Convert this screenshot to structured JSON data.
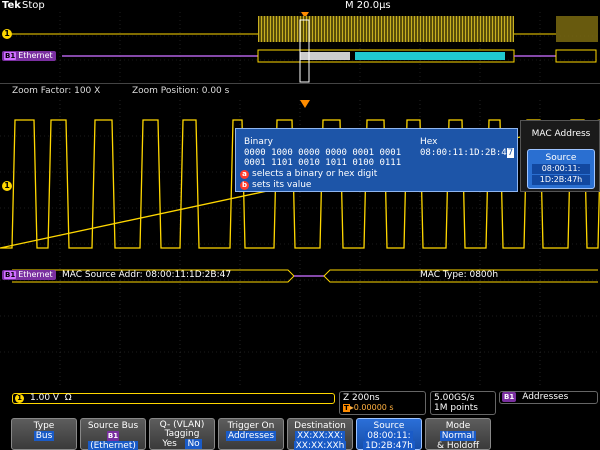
{
  "top": {
    "logo": "Tek",
    "acq_state": "Stop",
    "timebase": "M 20.0µs"
  },
  "overview": {
    "bus_label": "Ethernet",
    "bus_badge": "B1"
  },
  "zoom": {
    "factor": "Zoom Factor: 100 X",
    "position": "Zoom Position: 0.00 s"
  },
  "main": {
    "bus_label": "Ethernet",
    "bus_badge": "B1",
    "channel_marker": "1",
    "decode_left": "MAC Source Addr: 08:00:11:1D:2B:47",
    "decode_right": "MAC Type: 0800h"
  },
  "popup": {
    "binary_label": "Binary",
    "hex_label": "Hex",
    "binary_line1": "0000 1000  0000 0000  0001 0001",
    "binary_line2": "0001 1101  0010 1011  0100 0111",
    "hex_value_prefix": "08:00:11:1D:2B:4",
    "hex_value_cursor": "7",
    "hint_a_knob": "a",
    "hint_a": "selects a binary or hex digit",
    "hint_b_knob": "b",
    "hint_b": "sets its value"
  },
  "side_menu": {
    "title": "MAC Address",
    "source_label": "Source",
    "source_line1": "08:00:11:",
    "source_line2": "1D:2B:47h"
  },
  "info": {
    "ch1_badge": "1",
    "ch1_scale": "1.00 V",
    "ch1_term": "Ω",
    "horiz_scale": "Z 200ns",
    "horiz_trig_mark": "T",
    "horiz_delay": "▸0.00000 s",
    "sample_rate": "5.00GS/s",
    "record_length": "1M points",
    "bus_badge": "B1",
    "bus_trigger_type": "Addresses"
  },
  "bottom_menu": {
    "type_label": "Type",
    "type_value": "Bus",
    "source_bus_label": "Source Bus",
    "source_bus_badge": "B1",
    "source_bus_value": "(Ethernet)",
    "vlan_label": "Q- (VLAN)",
    "vlan_label2": "Tagging",
    "vlan_yes": "Yes",
    "vlan_no": "No",
    "trigger_on_label": "Trigger On",
    "trigger_on_value": "Addresses",
    "destination_label": "Destination",
    "destination_line1": "XX:XX:XX:",
    "destination_line2": "XX:XX:XXh",
    "source_label": "Source",
    "source_line1": "08:00:11:",
    "source_line2": "1D:2B:47h",
    "mode_label": "Mode",
    "mode_value1": "Normal",
    "mode_value2": "& Holdoff"
  },
  "colors": {
    "channel1": "#ffd700",
    "bus": "#7a2fa0",
    "popup_bg": "#1d55a8",
    "menu_active": "#2b6fd8",
    "trigger": "#ff8c00"
  }
}
